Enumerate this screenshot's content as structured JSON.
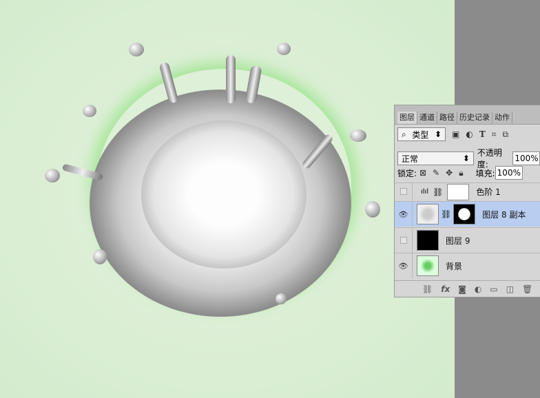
{
  "panel": {
    "tabs": [
      "图层",
      "通道",
      "路径",
      "历史记录",
      "动作"
    ],
    "filter": {
      "label": "类型",
      "icons": [
        "image-filter-icon",
        "adjustment-filter-icon",
        "type-filter-icon",
        "shape-filter-icon",
        "smart-object-filter-icon"
      ],
      "type_glyph": "T"
    },
    "blend_mode": "正常",
    "opacity_label": "不透明度:",
    "opacity": "100%",
    "lock_label": "锁定:",
    "fill_label": "填充:",
    "fill": "100%",
    "layers": [
      {
        "name": "色阶 1",
        "visible": false,
        "type": "levels adjustment"
      },
      {
        "name": "图层 8 副本",
        "visible": true,
        "selected": true,
        "has_mask": true
      },
      {
        "name": "图层 9",
        "visible": false
      },
      {
        "name": "背景",
        "visible": true
      }
    ],
    "footer_icons": [
      "link-icon",
      "fx-icon",
      "mask-icon",
      "adjustment-icon",
      "folder-icon",
      "new-layer-icon",
      "trash-icon"
    ],
    "fx_label": "fx",
    "colors": {
      "selected": "#b8cdf0",
      "panel": "#d6d6d6",
      "canvas": "#dcefd5"
    }
  }
}
